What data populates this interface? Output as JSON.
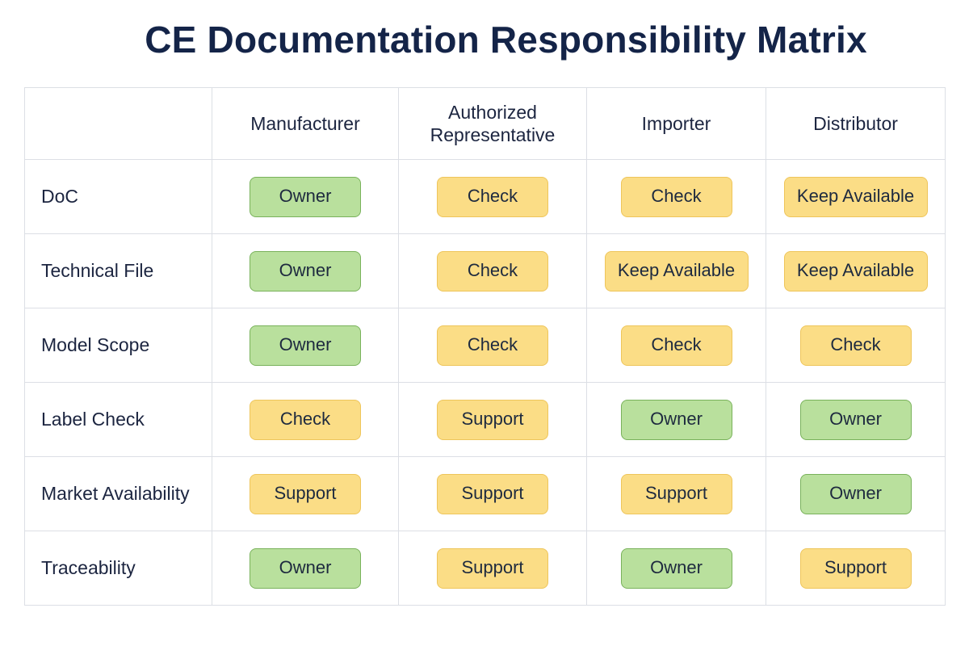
{
  "title": "CE Documentation Responsibility Matrix",
  "columns": [
    "Manufacturer",
    "Authorized Representative",
    "Importer",
    "Distributor"
  ],
  "column_lines": [
    [
      "Manufacturer"
    ],
    [
      "Authorized",
      "Representative"
    ],
    [
      "Importer"
    ],
    [
      "Distributor"
    ]
  ],
  "status_colors": {
    "Owner": {
      "fill": "#b9e09d",
      "border": "#79b25b"
    },
    "Check": {
      "fill": "#fbdd86",
      "border": "#eec55b"
    },
    "Support": {
      "fill": "#fbdd86",
      "border": "#eec55b"
    },
    "Keep Available": {
      "fill": "#fbdd86",
      "border": "#eec55b"
    }
  },
  "rows": [
    {
      "label": "DoC",
      "cells": [
        "Owner",
        "Check",
        "Check",
        "Keep Available"
      ]
    },
    {
      "label": "Technical File",
      "cells": [
        "Owner",
        "Check",
        "Keep Available",
        "Keep Available"
      ]
    },
    {
      "label": "Model Scope",
      "cells": [
        "Owner",
        "Check",
        "Check",
        "Check"
      ]
    },
    {
      "label": "Label Check",
      "cells": [
        "Check",
        "Support",
        "Owner",
        "Owner"
      ]
    },
    {
      "label": "Market Availability",
      "cells": [
        "Support",
        "Support",
        "Support",
        "Owner"
      ]
    },
    {
      "label": "Traceability",
      "cells": [
        "Owner",
        "Support",
        "Owner",
        "Support"
      ]
    }
  ]
}
